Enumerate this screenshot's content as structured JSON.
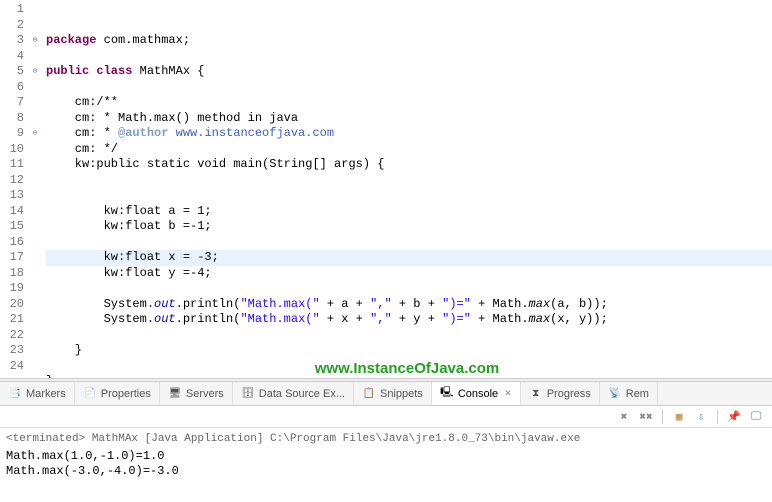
{
  "lines": [
    {
      "n": 1,
      "f": "",
      "t": "kw:package| com.mathmax;",
      "b": "code.l1"
    },
    {
      "n": 2,
      "f": "",
      "t": "",
      "b": "code.l2"
    },
    {
      "n": 3,
      "f": "⊖",
      "t": "kw:public class| MathMAx {",
      "b": "code.l3"
    },
    {
      "n": 4,
      "f": "",
      "t": "",
      "b": "code.l4"
    },
    {
      "n": 5,
      "f": "⊖",
      "t": "    cm:/**",
      "b": "code.l5"
    },
    {
      "n": 6,
      "f": "",
      "t": "    cm: * Math.max() method in java",
      "b": "code.l6"
    },
    {
      "n": 7,
      "f": "",
      "t": "    cm: * |cmk:@author|cm: www.instanceofjava.com",
      "b": "code.l7"
    },
    {
      "n": 8,
      "f": "",
      "t": "    cm: */",
      "b": "code.l8"
    },
    {
      "n": 9,
      "f": "⊖",
      "t": "    kw:public static void| main(String[] args) {",
      "b": "code.l9"
    },
    {
      "n": 10,
      "f": "",
      "t": "",
      "b": "code.l10"
    },
    {
      "n": 11,
      "f": "",
      "t": "",
      "b": "code.l11"
    },
    {
      "n": 12,
      "f": "",
      "t": "        kw:float| a = 1;",
      "b": "code.l12"
    },
    {
      "n": 13,
      "f": "",
      "t": "        kw:float| b =-1;",
      "b": "code.l13"
    },
    {
      "n": 14,
      "f": "",
      "t": "",
      "b": "code.l14"
    },
    {
      "n": 15,
      "f": "",
      "t": "        kw:float| x = -3;",
      "b": "code.l15",
      "hl": true
    },
    {
      "n": 16,
      "f": "",
      "t": "        kw:float| y =-4;",
      "b": "code.l16"
    },
    {
      "n": 17,
      "f": "",
      "t": "",
      "b": "code.l17"
    },
    {
      "n": 18,
      "f": "",
      "t": "        System.|fld:out|.println(|str:\"Math.max(\"| + a + |str:\",\"| + b + |str:\")=\"| + Math.|mth:max|(a, b));",
      "b": "code.l18"
    },
    {
      "n": 19,
      "f": "",
      "t": "        System.|fld:out|.println(|str:\"Math.max(\"| + x + |str:\",\"| + y + |str:\")=\"| + Math.|mth:max|(x, y));",
      "b": "code.l19"
    },
    {
      "n": 20,
      "f": "",
      "t": "",
      "b": "code.l20"
    },
    {
      "n": 21,
      "f": "",
      "t": "    }",
      "b": "code.l21"
    },
    {
      "n": 22,
      "f": "",
      "t": "",
      "b": "code.l22"
    },
    {
      "n": 23,
      "f": "",
      "t": "}",
      "b": "code.l23"
    },
    {
      "n": 24,
      "f": "",
      "t": "",
      "b": "code.l24"
    }
  ],
  "watermark": "www.InstanceOfJava.com",
  "tabs": {
    "markers": "Markers",
    "properties": "Properties",
    "servers": "Servers",
    "datasource": "Data Source Ex...",
    "snippets": "Snippets",
    "console": "Console",
    "progress": "Progress",
    "rem": "Rem"
  },
  "console": {
    "title": "<terminated> MathMAx [Java Application] C:\\Program Files\\Java\\jre1.8.0_73\\bin\\javaw.exe",
    "out1": "Math.max(1.0,-1.0)=1.0",
    "out2": "Math.max(-3.0,-4.0)=-3.0"
  }
}
